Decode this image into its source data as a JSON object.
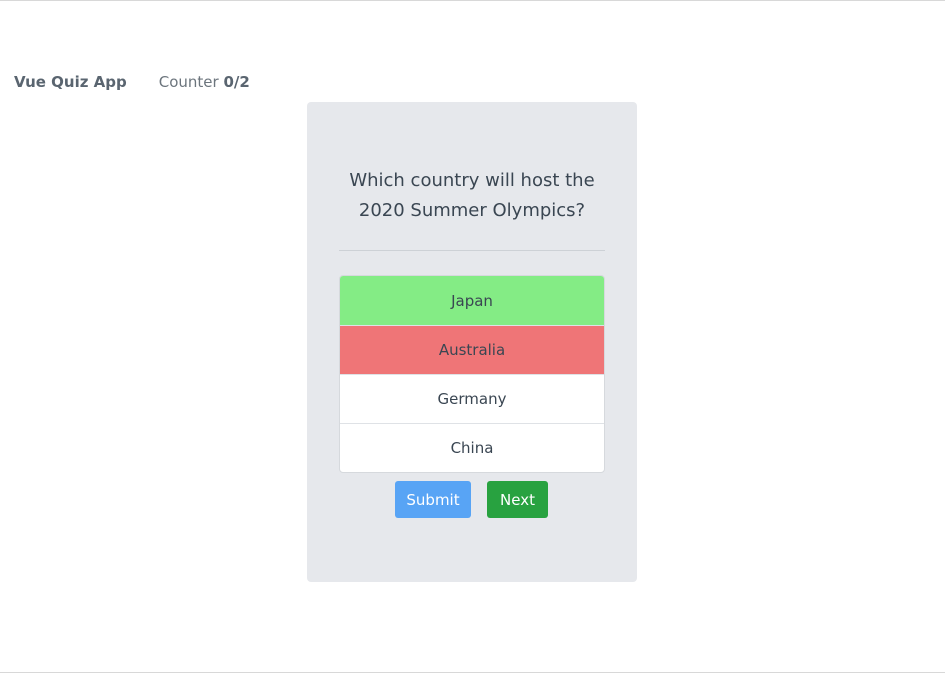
{
  "navbar": {
    "brand": "Vue Quiz App",
    "counter_label": "Counter",
    "counter_value": "0/2"
  },
  "quiz": {
    "question": "Which country will host the 2020 Summer Olympics?",
    "answers": [
      {
        "label": "Japan",
        "state": "correct"
      },
      {
        "label": "Australia",
        "state": "incorrect"
      },
      {
        "label": "Germany",
        "state": "neutral"
      },
      {
        "label": "China",
        "state": "neutral"
      }
    ],
    "submit_label": "Submit",
    "next_label": "Next"
  },
  "colors": {
    "correct": "#84ec85",
    "incorrect": "#ef7577",
    "submit": "#58a4f5",
    "next": "#28a240",
    "card_background": "#e6e8ec"
  }
}
